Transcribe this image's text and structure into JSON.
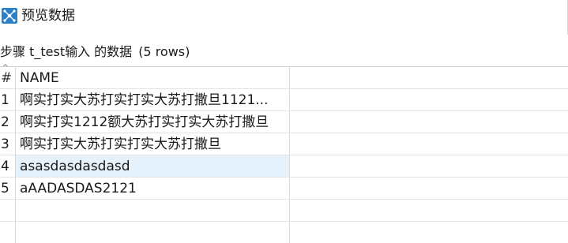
{
  "window": {
    "title": "预览数据",
    "icon": "kettle-preview-icon"
  },
  "step_info": {
    "text": "步骤 t_test输入 的数据",
    "count": "(5 rows)"
  },
  "table": {
    "columns": [
      "#",
      "NAME"
    ],
    "rows": [
      {
        "num": "1",
        "name": "啊实打实大苏打实打实大苏打撒旦1121..."
      },
      {
        "num": "2",
        "name": "啊实打实1212额大苏打实打实大苏打撒旦"
      },
      {
        "num": "3",
        "name": "啊实打实大苏打实打实大苏打撒旦"
      },
      {
        "num": "4",
        "name": "asasdasdasdasd"
      },
      {
        "num": "5",
        "name": "aAADASDAS2121"
      }
    ],
    "selected_row": "4"
  },
  "colors": {
    "selected_row_bg": "#e5f1fb",
    "icon_blue": "#2f7fc4",
    "grid_line": "#d9d9d9"
  }
}
